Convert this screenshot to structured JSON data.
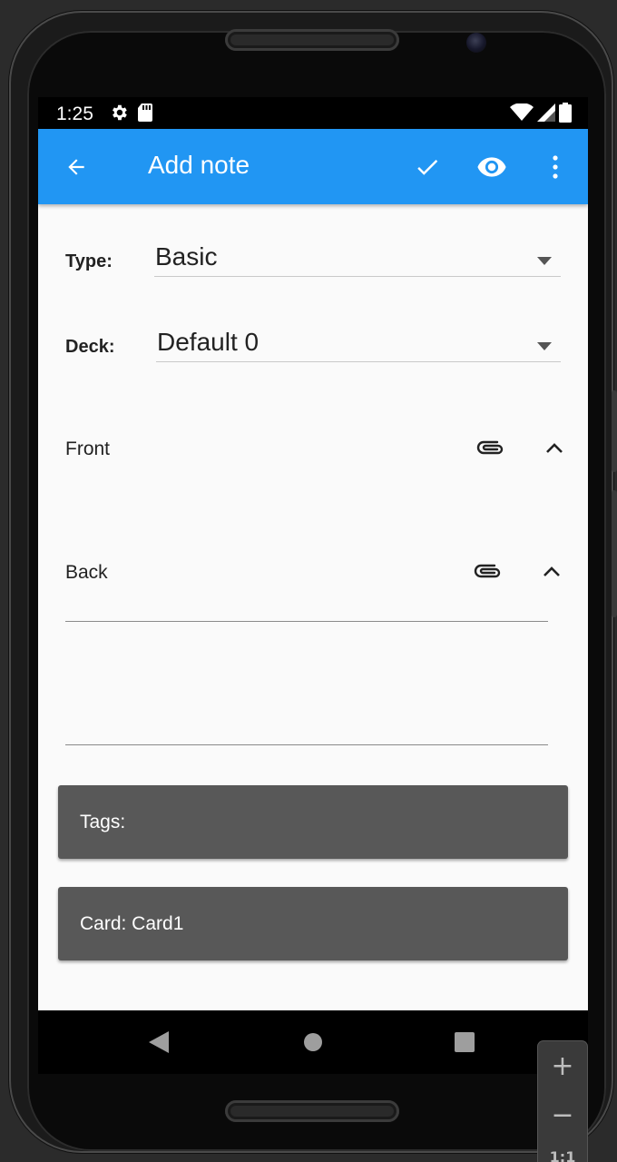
{
  "status_bar": {
    "time": "1:25",
    "left_icons": [
      "gear-icon",
      "sd-card-icon"
    ],
    "right_icons": [
      "wifi-icon",
      "signal-icon",
      "battery-icon"
    ]
  },
  "app_bar": {
    "title": "Add note",
    "actions": [
      "back-arrow-icon",
      "checkmark-icon",
      "eye-icon",
      "overflow-menu-icon"
    ],
    "color": "#2196F3"
  },
  "form": {
    "type_label": "Type:",
    "type_value": "Basic",
    "deck_label": "Deck:",
    "deck_value": "Default 0"
  },
  "fields": [
    {
      "label": "Front",
      "value": ""
    },
    {
      "label": "Back",
      "value": ""
    }
  ],
  "buttons": {
    "tags_label": "Tags:",
    "card_label": "Card: Card1",
    "color": "#585858"
  },
  "zoom": {
    "plus": "+",
    "minus": "−",
    "one_to_one": "1:1"
  }
}
